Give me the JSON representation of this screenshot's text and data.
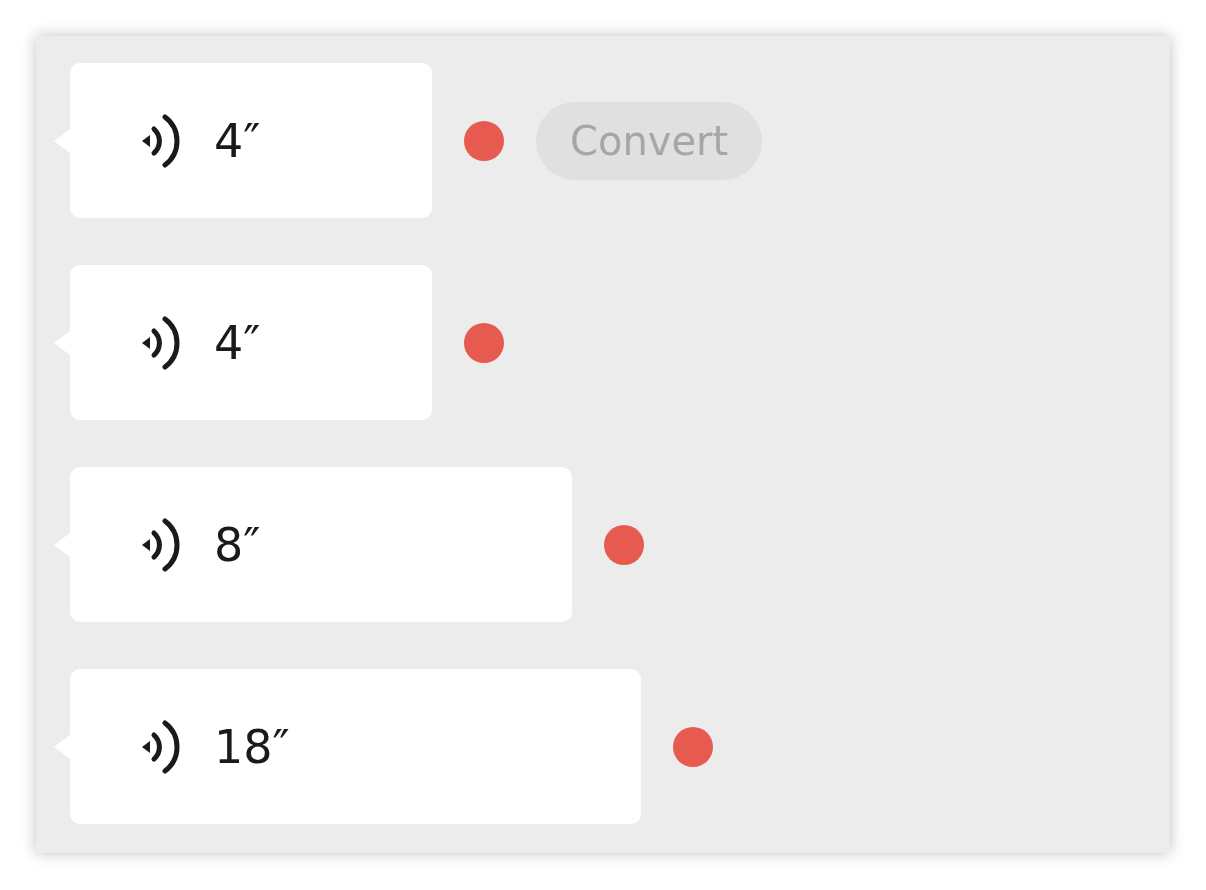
{
  "messages": [
    {
      "duration": "4″",
      "unread": true,
      "action": "Convert"
    },
    {
      "duration": "4″",
      "unread": true
    },
    {
      "duration": "8″",
      "unread": true
    },
    {
      "duration": "18″",
      "unread": true
    }
  ]
}
